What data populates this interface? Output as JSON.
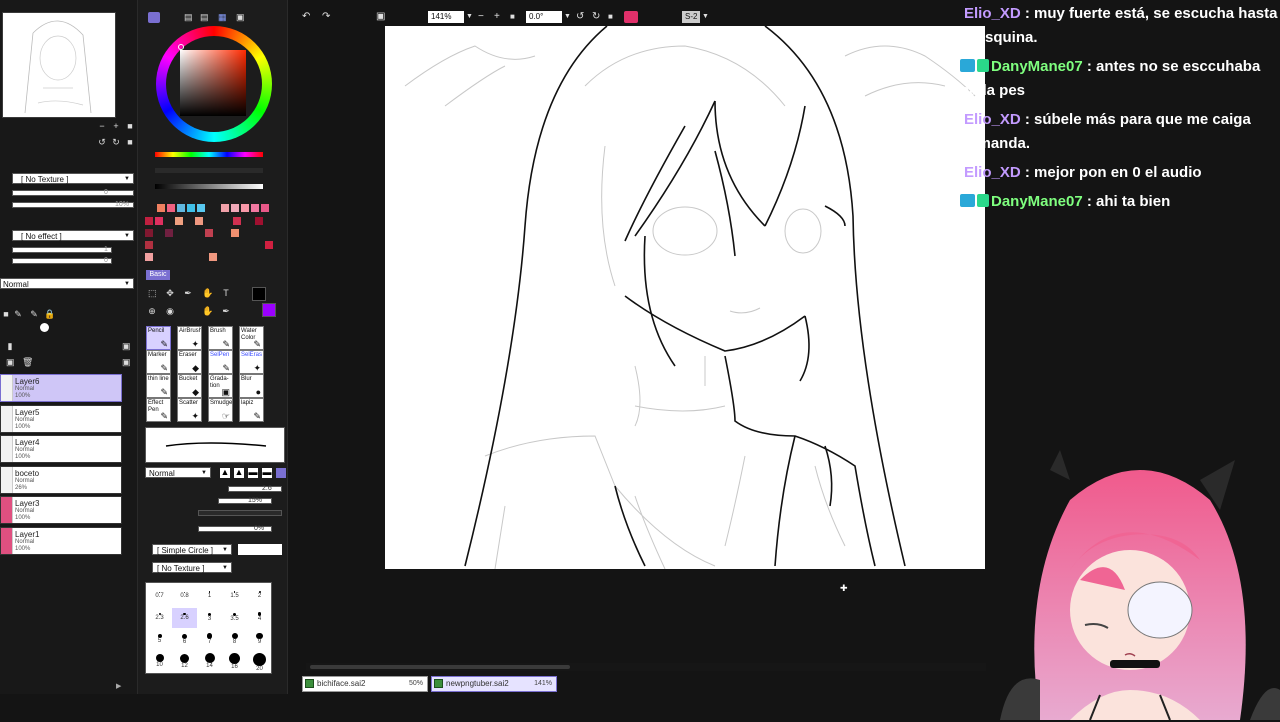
{
  "app": {
    "colors": {
      "accent": "#7a6fd1",
      "chat_user_purple": "#c39bff",
      "chat_user_green": "#7fff7f",
      "selected_color": "#9b00ff"
    }
  },
  "left_panel": {
    "texture_select": "[ No Texture ]",
    "effect_select": "[ No effect ]",
    "slider_a_value": "0",
    "slider_b_value": "10%",
    "slider_c_value": "1",
    "slider_d_value": "0",
    "blend_mode": "Normal",
    "layers": [
      {
        "name": "Layer6",
        "mode": "Normal",
        "opacity": "100%",
        "selected": true
      },
      {
        "name": "Layer5",
        "mode": "Normal",
        "opacity": "100%",
        "selected": false
      },
      {
        "name": "Layer4",
        "mode": "Normal",
        "opacity": "100%",
        "selected": false
      },
      {
        "name": "boceto",
        "mode": "Normal",
        "opacity": "26%",
        "selected": false
      },
      {
        "name": "Layer3",
        "mode": "Normal",
        "opacity": "100%",
        "selected": false
      },
      {
        "name": "Layer1",
        "mode": "Normal",
        "opacity": "100%",
        "selected": false
      }
    ]
  },
  "tool_panel": {
    "tab_basic": "Basic",
    "tools": [
      {
        "label": "Pencil",
        "glyph": "✎"
      },
      {
        "label": "AirBrush",
        "glyph": "✦"
      },
      {
        "label": "Brush",
        "glyph": "✎"
      },
      {
        "label": "Water Color",
        "glyph": "✎"
      },
      {
        "label": "Marker",
        "glyph": "✎"
      },
      {
        "label": "Eraser",
        "glyph": "◆"
      },
      {
        "label": "SelPen",
        "glyph": "✎"
      },
      {
        "label": "SelEras",
        "glyph": "✦"
      },
      {
        "label": "thin line",
        "glyph": "✎"
      },
      {
        "label": "Bucket",
        "glyph": "◆"
      },
      {
        "label": "Grada-tion",
        "glyph": "▣"
      },
      {
        "label": "Blur",
        "glyph": "●"
      },
      {
        "label": "Effect Pen",
        "glyph": "✎"
      },
      {
        "label": "Scatter",
        "glyph": "✦"
      },
      {
        "label": "Smudge",
        "glyph": "☞"
      },
      {
        "label": "lapiz",
        "glyph": "✎"
      }
    ],
    "brush_mode": "Normal",
    "brush_size_value": "2.6",
    "min_size_value": "15%",
    "density_value": "",
    "min_density_value": "0%",
    "shape_select": "[ Simple Circle ]",
    "texture_select": "[ No Texture ]",
    "brush_sizes": [
      [
        "0.7",
        "0.8",
        "1",
        "1.5",
        "2"
      ],
      [
        "2.3",
        "2.6",
        "3",
        "3.5",
        "4"
      ],
      [
        "5",
        "6",
        "7",
        "8",
        "9"
      ],
      [
        "10",
        "12",
        "14",
        "16",
        "20"
      ]
    ]
  },
  "toolbar": {
    "zoom": "141%",
    "rotation": "0.0°",
    "stabilizer": "S-2"
  },
  "documents": [
    {
      "name": "bichiface.sai2",
      "zoom": "50%",
      "active": false
    },
    {
      "name": "newpngtuber.sai2",
      "zoom": "141%",
      "active": true
    }
  ],
  "chat": [
    {
      "user": "Elio_XD",
      "text": " : muy fuerte está, se escucha hasta la esquina.",
      "color": "#c39bff",
      "badge": false
    },
    {
      "user": "DanyMane07",
      "text": " : antes no se esccuhaba nada pes",
      "color": "#7fff7f",
      "badge": true
    },
    {
      "user": "Elio_XD",
      "text": " : súbele más para que me caiga demanda.",
      "color": "#c39bff",
      "badge": false
    },
    {
      "user": "Elio_XD",
      "text": " : mejor pon en 0 el audio",
      "color": "#c39bff",
      "badge": false
    },
    {
      "user": "DanyMane07",
      "text": " : ahi ta bien",
      "color": "#7fff7f",
      "badge": true
    }
  ]
}
